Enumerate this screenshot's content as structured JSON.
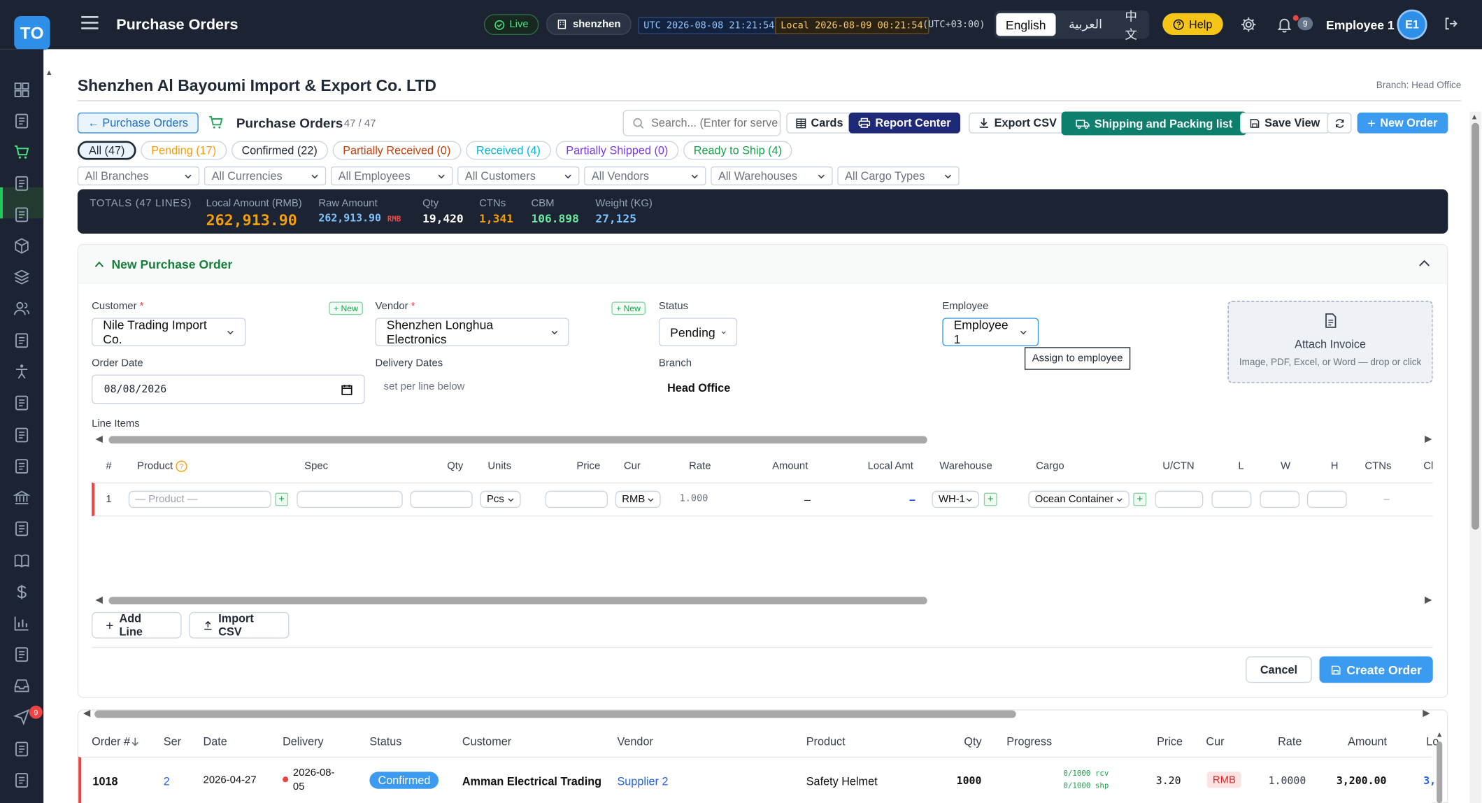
{
  "app": {
    "logo": "TO",
    "title": "Purchase Orders",
    "live_label": "Live",
    "site": "shenzhen",
    "utc_clock": "UTC 2026-08-08 21:21:54",
    "local_clock": "Local 2026-08-09 00:21:54",
    "tz_offset": "(UTC+03:00)",
    "languages": [
      "English",
      "العربية",
      "中文"
    ],
    "active_language": "English",
    "help_label": "Help",
    "notification_count": "9",
    "user_name": "Employee 1",
    "user_initials": "E1"
  },
  "sidebar": {
    "icons": [
      "dashboard-icon",
      "clipboard-icon",
      "cart-icon",
      "clipboard-check-icon",
      "archive-icon",
      "package-icon",
      "layers-icon",
      "users-icon",
      "contact-card-icon",
      "accessibility-icon",
      "ship-icon",
      "invoice-icon",
      "wallet-icon",
      "bank-icon",
      "document-icon",
      "book-icon",
      "dollar-icon",
      "bar-chart-icon",
      "coins-icon",
      "inbox-icon",
      "send-icon",
      "team-icon",
      "calendar-settings-icon"
    ],
    "active": "cart-icon",
    "send_badge": "9"
  },
  "page": {
    "company": "Shenzhen Al Bayoumi Import & Export Co. LTD",
    "branch_label": "Branch: Head Office",
    "back_label": "← Purchase Orders",
    "section_title": "Purchase Orders",
    "section_count": "47 / 47",
    "search_placeholder": "Search... (Enter for server",
    "buttons": {
      "cards": "Cards",
      "report_center": "Report Center",
      "export_csv": "Export CSV",
      "shipping": "Shipping and Packing list",
      "save_view": "Save View",
      "new_order": "New Order"
    },
    "status_chips": [
      {
        "label": "All (47)",
        "color": "#1f2937",
        "active": true
      },
      {
        "label": "Pending (17)",
        "color": "#f59e0b"
      },
      {
        "label": "Confirmed (22)",
        "color": "#1f2937"
      },
      {
        "label": "Partially Received (0)",
        "color": "#c2410c"
      },
      {
        "label": "Received (4)",
        "color": "#06b6d4"
      },
      {
        "label": "Partially Shipped (0)",
        "color": "#7c3aed"
      },
      {
        "label": "Ready to Ship (4)",
        "color": "#16a34a"
      }
    ],
    "filters": [
      "All Branches",
      "All Currencies",
      "All Employees",
      "All Customers",
      "All Vendors",
      "All Warehouses",
      "All Cargo Types"
    ],
    "totals": {
      "label": "TOTALS (47 LINES)",
      "local_amount_label": "Local Amount (RMB)",
      "local_amount": "262,913.90",
      "raw_amount_label": "Raw Amount",
      "raw_amount": "262,913.90",
      "raw_currency": "RMB",
      "qty_label": "Qty",
      "qty": "19,420",
      "ctns_label": "CTNs",
      "ctns": "1,341",
      "cbm_label": "CBM",
      "cbm": "106.898",
      "weight_label": "Weight (KG)",
      "weight": "27,125"
    }
  },
  "new_order": {
    "title": "New Purchase Order",
    "customer_label": "Customer",
    "customer_value": "Nile Trading Import Co.",
    "new_label": "+ New",
    "vendor_label": "Vendor",
    "vendor_value": "Shenzhen Longhua Electronics",
    "status_label": "Status",
    "status_value": "Pending",
    "employee_label": "Employee",
    "employee_value": "Employee 1",
    "tooltip": "Assign to employee",
    "attach_title": "Attach Invoice",
    "attach_sub": "Image, PDF, Excel, or Word — drop or click",
    "order_date_label": "Order Date",
    "order_date": "08/08/2026",
    "delivery_label": "Delivery Dates",
    "delivery_value": "set per line below",
    "branch_label": "Branch",
    "branch_value": "Head Office",
    "line_items_label": "Line Items",
    "columns": [
      "#",
      "Product",
      "Spec",
      "Qty",
      "Units",
      "Price",
      "Cur",
      "Rate",
      "Amount",
      "Local Amt",
      "Warehouse",
      "Cargo",
      "U/CTN",
      "L",
      "W",
      "H",
      "CTNs",
      "Cl"
    ],
    "line": {
      "num": "1",
      "product_placeholder": "— Product —",
      "units": "Pcs",
      "currency": "RMB",
      "rate": "1.000",
      "amount": "–",
      "local_amount": "–",
      "warehouse": "WH-1",
      "cargo": "Ocean Container",
      "ctns": "–"
    },
    "add_line": "Add Line",
    "import_csv": "Import CSV",
    "cancel": "Cancel",
    "create": "Create Order"
  },
  "orders_table": {
    "columns": [
      "Order #",
      "Ser",
      "Date",
      "Delivery",
      "Status",
      "Customer",
      "Vendor",
      "Product",
      "Qty",
      "Progress",
      "Price",
      "Cur",
      "Rate",
      "Amount",
      "Lo"
    ],
    "rows": [
      {
        "order": "1018",
        "ser": "2",
        "date": "2026-04-27",
        "delivery_line1": "2026-08-",
        "delivery_line2": "05",
        "status": "Confirmed",
        "customer": "Amman Electrical Trading",
        "vendor": "Supplier 2",
        "product": "Safety Helmet",
        "qty": "1000",
        "progress_rcv": "0/1000 rcv",
        "progress_shp": "0/1000 shp",
        "price": "3.20",
        "currency": "RMB",
        "rate": "1.0000",
        "amount": "3,200.00",
        "local": "3,"
      }
    ]
  }
}
